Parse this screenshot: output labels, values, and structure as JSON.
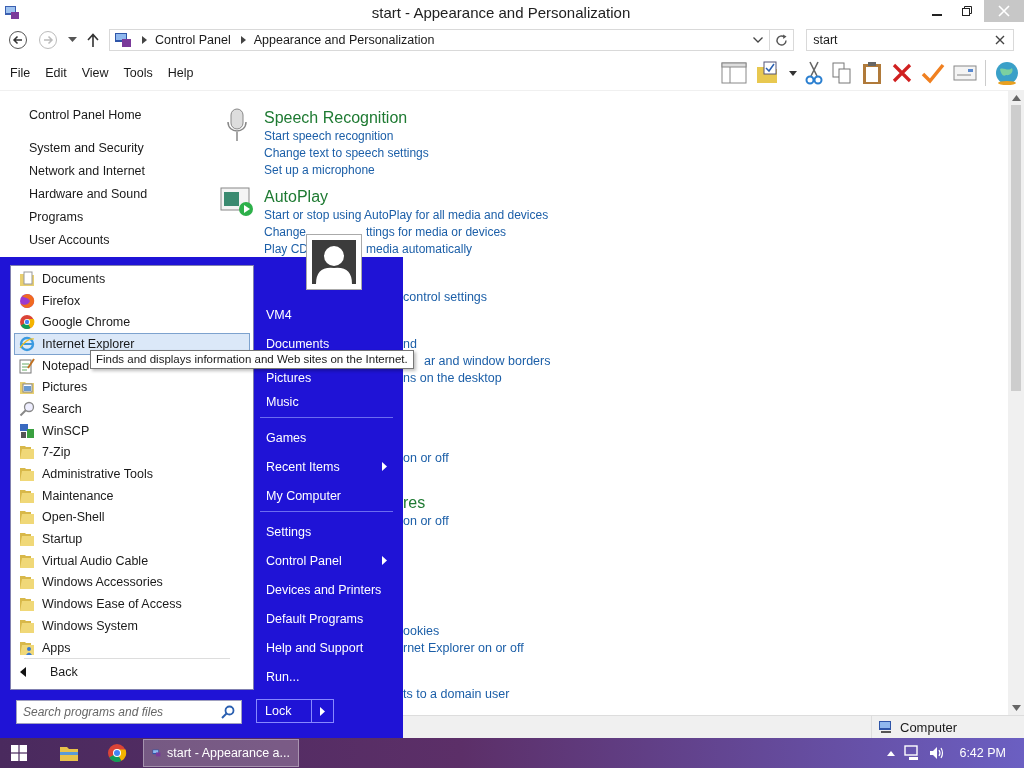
{
  "window": {
    "title": "start - Appearance and Personalization"
  },
  "address_bar": {
    "breadcrumbs": [
      "Control Panel",
      "Appearance and Personalization"
    ]
  },
  "search": {
    "value": "start"
  },
  "menu_bar": [
    "File",
    "Edit",
    "View",
    "Tools",
    "Help"
  ],
  "sidebar": {
    "items": [
      "Control Panel Home",
      "System and Security",
      "Network and Internet",
      "Hardware and Sound",
      "Programs",
      "User Accounts"
    ]
  },
  "sections": [
    {
      "title": "Speech Recognition",
      "lines": [
        [
          "Start speech recognition"
        ],
        [
          "Change text to speech settings"
        ],
        [
          "Set up a microphone"
        ]
      ]
    },
    {
      "title": "AutoPlay",
      "lines": [
        [
          "Start or stop using AutoPlay for all media and devices"
        ],
        [
          "Change",
          "ttings for media or devices"
        ],
        [
          "Play CD",
          "media automatically"
        ]
      ]
    }
  ],
  "fragments": [
    {
      "kind": "link",
      "text": "control settings"
    },
    {
      "kind": "link",
      "text": "nd"
    },
    {
      "kind": "link",
      "text": "ar and window borders"
    },
    {
      "kind": "link",
      "text": "ns on the desktop"
    },
    {
      "kind": "link",
      "text": "on or off"
    },
    {
      "kind": "heading",
      "text": "res"
    },
    {
      "kind": "link",
      "text": "on or off"
    },
    {
      "kind": "link",
      "text": "ookies"
    },
    {
      "kind": "link",
      "text": "rnet Explorer on or off"
    },
    {
      "kind": "link",
      "text": "ts to a domain user"
    }
  ],
  "start_menu": {
    "programs": [
      {
        "label": "Documents",
        "kind": "documents",
        "selected": false
      },
      {
        "label": "Firefox",
        "kind": "orange-globe",
        "selected": false
      },
      {
        "label": "Google Chrome",
        "kind": "tricolor",
        "selected": false
      },
      {
        "label": "Internet Explorer",
        "kind": "e-globe",
        "selected": true
      },
      {
        "label": "Notepad",
        "kind": "notepad",
        "selected": false
      },
      {
        "label": "Pictures",
        "kind": "pictures",
        "selected": false
      },
      {
        "label": "Search",
        "kind": "magnifier",
        "selected": false
      },
      {
        "label": "WinSCP",
        "kind": "network",
        "selected": false
      },
      {
        "label": "7-Zip",
        "kind": "folder",
        "selected": false
      },
      {
        "label": "Administrative Tools",
        "kind": "folder",
        "selected": false
      },
      {
        "label": "Maintenance",
        "kind": "folder",
        "selected": false
      },
      {
        "label": "Open-Shell",
        "kind": "folder",
        "selected": false
      },
      {
        "label": "Startup",
        "kind": "folder",
        "selected": false
      },
      {
        "label": "Virtual Audio Cable",
        "kind": "folder",
        "selected": false
      },
      {
        "label": "Windows Accessories",
        "kind": "folder",
        "selected": false
      },
      {
        "label": "Windows Ease of Access",
        "kind": "folder",
        "selected": false
      },
      {
        "label": "Windows System",
        "kind": "folder",
        "selected": false
      },
      {
        "label": "Apps",
        "kind": "folder-user",
        "selected": false
      }
    ],
    "back": "Back",
    "search_placeholder": "Search programs and files",
    "places": [
      [
        {
          "label": "VM4",
          "submenu": false
        },
        {
          "label": "Documents",
          "submenu": false
        },
        {
          "label": "Pictures",
          "submenu": false
        },
        {
          "label": "Music",
          "submenu": false
        }
      ],
      [
        {
          "label": "Games",
          "submenu": false
        },
        {
          "label": "Recent Items",
          "submenu": true
        },
        {
          "label": "My Computer",
          "submenu": false
        }
      ],
      [
        {
          "label": "Settings",
          "submenu": false
        },
        {
          "label": "Control Panel",
          "submenu": true
        },
        {
          "label": "Devices and Printers",
          "submenu": false
        },
        {
          "label": "Default Programs",
          "submenu": false
        },
        {
          "label": "Help and Support",
          "submenu": false
        },
        {
          "label": "Run...",
          "submenu": false
        }
      ]
    ],
    "lock": "Lock"
  },
  "tooltip": "Finds and displays information and Web sites on the Internet.",
  "status_bar": {
    "computer": "Computer"
  },
  "taskbar": {
    "window_button": "start - Appearance a...",
    "clock": "6:42 PM"
  }
}
